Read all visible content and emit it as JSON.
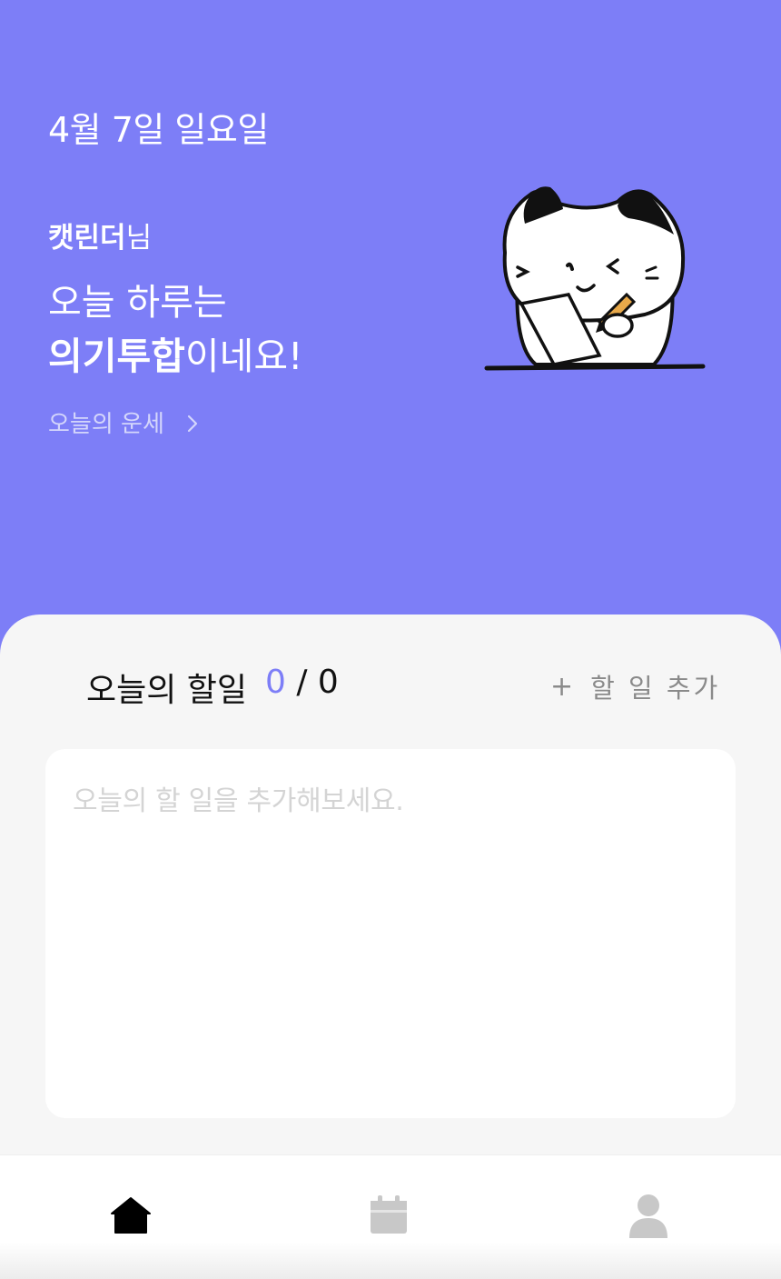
{
  "header": {
    "date": "4월 7일 일요일",
    "user_name": "캣린더",
    "user_suffix": "님",
    "message_line1": "오늘 하루는",
    "fortune_word": "의기투합",
    "message_suffix": "이네요!",
    "fortune_link_label": "오늘의 운세",
    "mascot_icon": "cat-writing-illustration"
  },
  "todo": {
    "title": "오늘의 할일",
    "done_count": "0",
    "separator": " / ",
    "total_count": "0",
    "add_label": "할 일 추가",
    "add_icon": "+",
    "empty_placeholder": "오늘의 할 일을 추가해보세요."
  },
  "tabbar": {
    "items": [
      {
        "icon": "home-icon",
        "active": true
      },
      {
        "icon": "calendar-icon",
        "active": false
      },
      {
        "icon": "user-icon",
        "active": false
      }
    ],
    "active_color": "#000000",
    "inactive_color": "#c8c8c8"
  },
  "colors": {
    "brand": "#7d7ef7",
    "background": "#f6f6f6",
    "card": "#ffffff"
  }
}
